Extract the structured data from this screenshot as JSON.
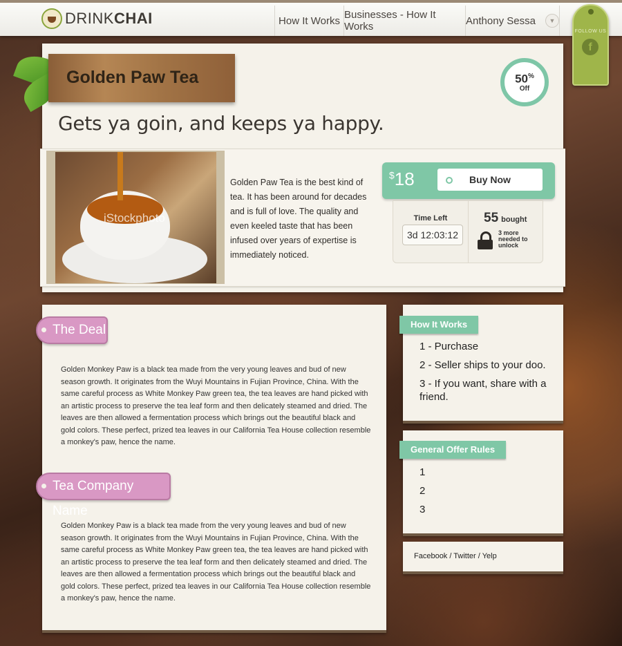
{
  "header": {
    "logo_light": "DRINK",
    "logo_bold": "CHAI",
    "nav": [
      {
        "label": "How It Works"
      },
      {
        "label": "Businesses - How It Works"
      },
      {
        "label": "Anthony Sessa"
      }
    ],
    "follow_tag": {
      "label": "FOLLOW US",
      "icon": "facebook-icon"
    }
  },
  "deal": {
    "name": "Golden Paw Tea",
    "tagline": "Gets ya goin, and keeps ya happy.",
    "discount_value": "50",
    "discount_unit": "%",
    "discount_label": "Off",
    "image_watermark": "iStockphoto",
    "description": "Golden Paw Tea is the best kind of tea. It has been around for decades and is full of love. The quality and even keeled taste that has been infused over years of expertise is immediately noticed.",
    "currency": "$",
    "price": "18",
    "buy_label": "Buy Now",
    "time_left_label": "Time Left",
    "time_left": "3d 12:03:12",
    "bought_count": "55",
    "bought_label": "bought",
    "needed_text": "3 more needed to unlock"
  },
  "sections": {
    "the_deal": {
      "title": "The Deal",
      "body": "Golden Monkey Paw is a black tea made from the very young leaves and bud of new season growth. It originates from the Wuyi Mountains in Fujian Province, China. With the same careful process as White Monkey Paw green tea, the tea leaves are hand picked with an artistic process to preserve the tea leaf form and then delicately steamed and dried. The leaves are then allowed a fermentation process which brings out the beautiful black and gold colors. These perfect, prized tea leaves in our California Tea House collection resemble a monkey's paw, hence the name."
    },
    "company": {
      "title": "Tea Company Name",
      "body": "Golden Monkey Paw is a black tea made from the very young leaves and bud of new season growth. It originates from the Wuyi Mountains in Fujian Province, China. With the same careful process as White Monkey Paw green tea, the tea leaves are hand picked with an artistic process to preserve the tea leaf form and then delicately steamed and dried. The leaves are then allowed a fermentation process which brings out the beautiful black and gold colors. These perfect, prized tea leaves in our California Tea House collection resemble a monkey's paw, hence the name."
    }
  },
  "sidebar": {
    "how_it_works": {
      "title": "How It Works",
      "items": [
        "1 - Purchase",
        "2 - Seller ships to your doo.",
        "3 - If you want, share with a friend."
      ]
    },
    "offer_rules": {
      "title": "General Offer Rules",
      "items": [
        "1",
        "2",
        "3"
      ]
    },
    "social": {
      "links": [
        "Facebook",
        "Twitter",
        "Yelp"
      ],
      "separator": "/"
    }
  },
  "colors": {
    "accent_green": "#7fc7a6",
    "tag_pink": "#d998c4",
    "follow_green": "#9fb54a"
  }
}
